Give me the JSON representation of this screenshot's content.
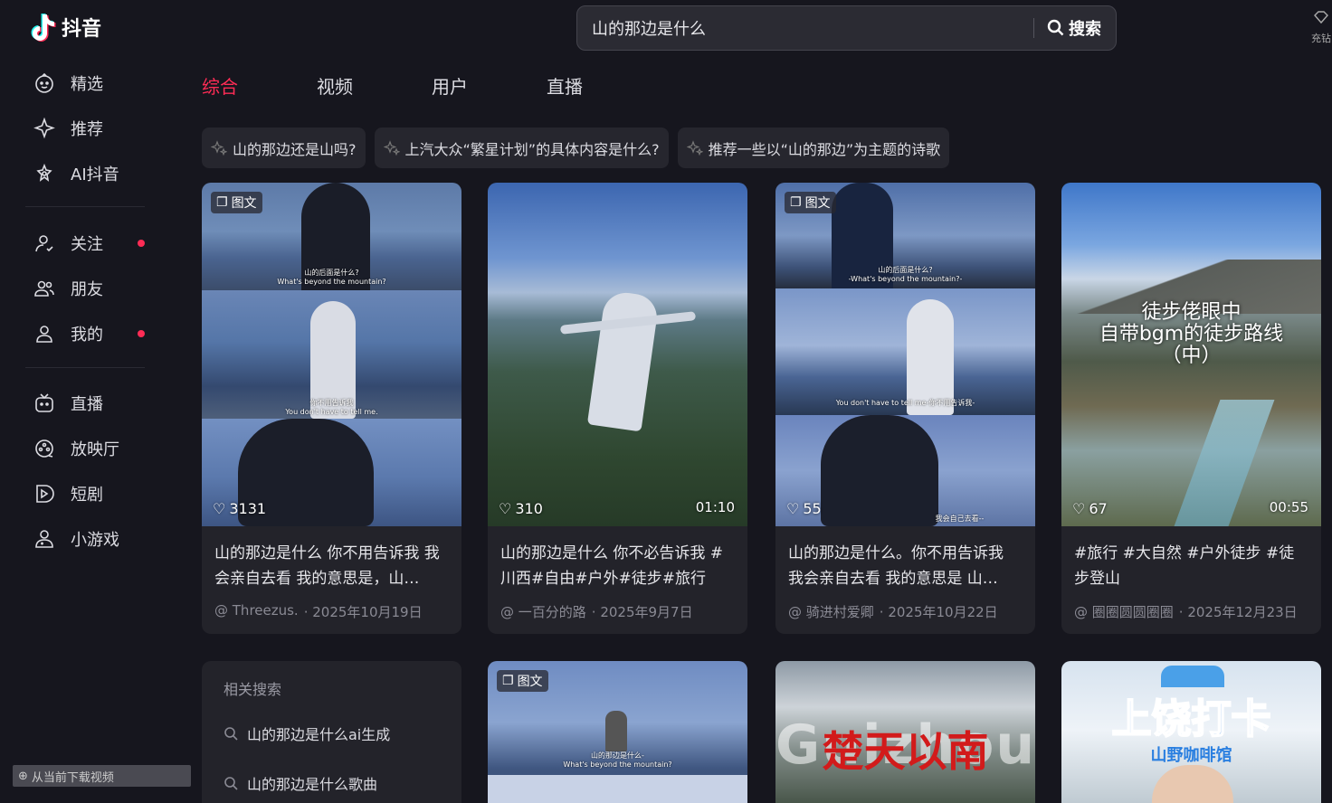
{
  "app": {
    "name": "抖音"
  },
  "sidebar": {
    "items": [
      {
        "label": "精选",
        "icon": "featured-icon"
      },
      {
        "label": "推荐",
        "icon": "recommend-icon"
      },
      {
        "label": "AI抖音",
        "icon": "ai-icon"
      },
      {
        "label": "关注",
        "icon": "follow-icon",
        "dot": true
      },
      {
        "label": "朋友",
        "icon": "friends-icon"
      },
      {
        "label": "我的",
        "icon": "profile-icon",
        "dot": true
      },
      {
        "label": "直播",
        "icon": "live-icon"
      },
      {
        "label": "放映厅",
        "icon": "cinema-icon"
      },
      {
        "label": "短剧",
        "icon": "drama-icon"
      },
      {
        "label": "小游戏",
        "icon": "game-icon"
      }
    ]
  },
  "search": {
    "value": "山的那边是什么",
    "button_label": "搜索"
  },
  "header": {
    "recharge_label": "充钻"
  },
  "tabs": [
    {
      "label": "综合",
      "active": true
    },
    {
      "label": "视频"
    },
    {
      "label": "用户"
    },
    {
      "label": "直播"
    }
  ],
  "suggestions": [
    "山的那边还是山吗?",
    "上汽大众“繁星计划”的具体内容是什么?",
    "推荐一些以“山的那边”为主题的诗歌"
  ],
  "cards": [
    {
      "tag": "图文",
      "likes": "3131",
      "duration": "",
      "captions": [
        "山的后面是什么?",
        "What's beyond the mountain?",
        "你不用告诉我",
        "You don't have to tell me."
      ],
      "description": "山的那边是什么 你不用告诉我 我会亲自去看 我的意思是，山…",
      "author": "@ Threezus.",
      "date": "· 2025年10月19日"
    },
    {
      "tag": "",
      "likes": "310",
      "duration": "01:10",
      "description": "山的那边是什么 你不必告诉我 #川西#自由#户外#徒步#旅行",
      "author": "@ 一百分的路",
      "date": "· 2025年9月7日"
    },
    {
      "tag": "图文",
      "likes": "55",
      "duration": "",
      "captions": [
        "山的后面是什么?",
        "-What's beyond the mountain?-",
        "You don't have to tell me-你不用告诉我-",
        "我会自己去看--"
      ],
      "description": "山的那边是什么。你不用告诉我 我会亲自去看 我的意思是 山…",
      "author": "@ 骑进村爱卿",
      "date": "· 2025年10月22日"
    },
    {
      "tag": "",
      "likes": "67",
      "duration": "00:55",
      "overlay": [
        "徒步佬眼中",
        "自带bgm的徒步路线",
        "（中）"
      ],
      "description": "#旅行 #大自然 #户外徒步 #徒步登山",
      "author": "@ 圈圈圆圆圈圈",
      "date": "· 2025年12月23日"
    }
  ],
  "related": {
    "title": "相关搜索",
    "items": [
      "山的那边是什么ai生成",
      "山的那边是什么歌曲"
    ]
  },
  "row2": [
    {
      "tag": "图文",
      "captions": [
        "山的那边是什么-",
        "What's beyond the mountain?"
      ]
    },
    {
      "overlay": "楚天以南",
      "bg_text": "Guizhou"
    },
    {
      "overlay": "上饶打卡",
      "sub": "山野咖啡馆"
    }
  ],
  "bottombar": {
    "label": "从当前下载视频"
  },
  "colors": {
    "accent": "#fe2c55",
    "bg": "#16161e",
    "card": "#23232a"
  }
}
